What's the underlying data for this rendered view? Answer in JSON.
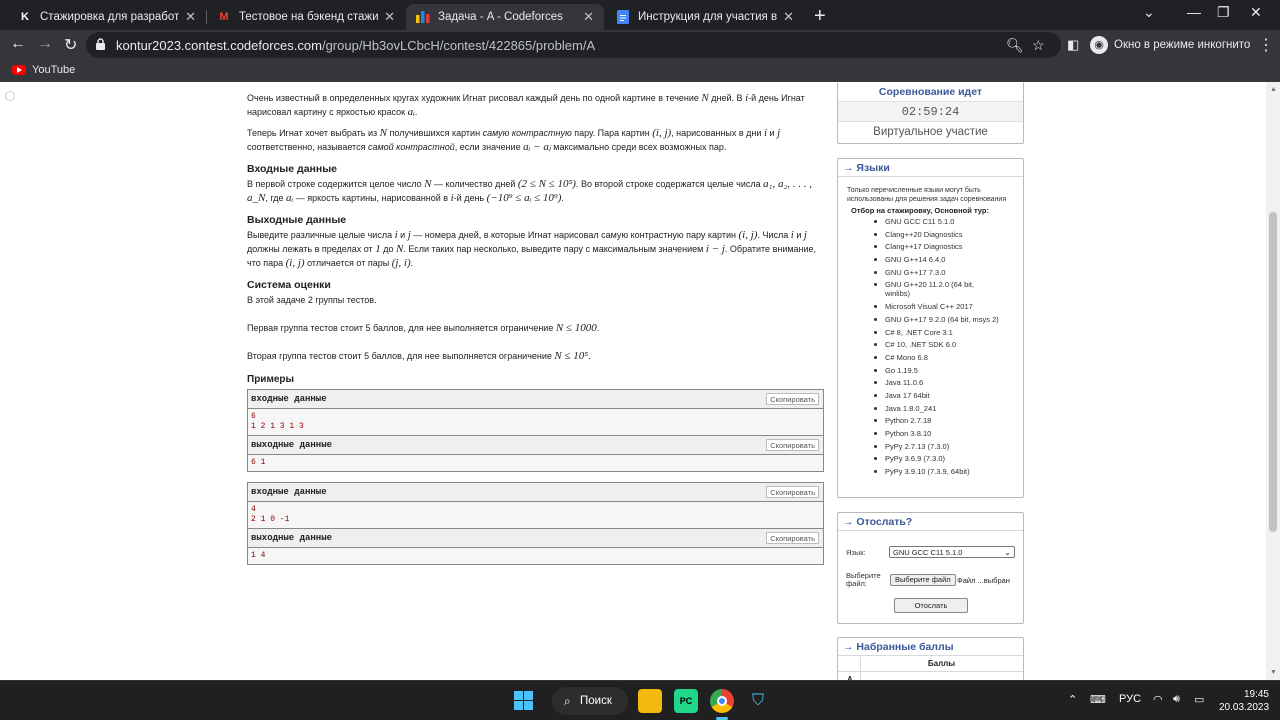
{
  "browser": {
    "tabs": [
      {
        "favicon": "K",
        "title": "Стажировка для разработчиков"
      },
      {
        "favicon": "M",
        "title": "Тестовое на бэкенд стажировку"
      },
      {
        "favicon": "cf-icon",
        "title": "Задача - A - Codeforces"
      },
      {
        "favicon": "docs-icon",
        "title": "Инструкция для участия в конте"
      }
    ],
    "url_host": "kontur2023.contest.codeforces.com",
    "url_path": "/group/Hb3ovLCbcH/contest/422865/problem/A",
    "incognito_label": "Окно в режиме инкогнито",
    "bookmark_youtube": "YouTube"
  },
  "problem": {
    "intro1_a": "Очень известный в определенных кругах художник Игнат рисовал каждый день по одной картине в течение",
    "intro1_n": "N",
    "intro1_b": "дней. В",
    "intro1_i": "i",
    "intro1_c": "-й день Игнат нарисовал картину с яркостью красок",
    "intro1_ai": "aᵢ",
    "intro2_a": "Теперь Игнат хочет выбрать из",
    "intro2_n": "N",
    "intro2_b": "получившихся картин",
    "intro2_em1": "самую контрастную",
    "intro2_c": "пару. Пара картин",
    "intro2_ij": "(i, j)",
    "intro2_d": ", нарисованных в дни",
    "intro2_i": "i",
    "intro2_e": "и",
    "intro2_j": "j",
    "intro2_f": "соответственно, называется",
    "intro2_em2": "самой контрастной",
    "intro2_g": ", если значение",
    "intro2_expr": "aᵢ − aⱼ",
    "intro2_h": "максимально среди всех возможных пар.",
    "input_title": "Входные данные",
    "input_a": "В первой строке содержится целое число",
    "input_n": "N",
    "input_b": "— количество дней",
    "input_range": "(2 ≤ N ≤ 10⁵)",
    "input_c": ". Во второй строке содержатся целые числа",
    "input_seq": "a₁, a₂, . . . , a_N",
    "input_d": ", где",
    "input_ai": "aᵢ",
    "input_e": "— яркость картины, нарисованной в",
    "input_i": "i",
    "input_f": "-й день",
    "input_range2": "(−10⁹ ≤ aᵢ ≤ 10⁹)",
    "output_title": "Выходные данные",
    "output_a": "Выведите различные целые числа",
    "output_i": "i",
    "output_b": "и",
    "output_j": "j",
    "output_c": "— номера дней, в которые Игнат нарисовал самую контрастную пару картин",
    "output_ij": "(i, j)",
    "output_d": ". Числа",
    "output_i2": "i",
    "output_e": "и",
    "output_j2": "j",
    "output_f": "должны лежать в пределах от",
    "output_1": "1",
    "output_g": "до",
    "output_n": "N",
    "output_h": ". Если таких пар несколько, выведите пару с максимальным значением",
    "output_expr": "i − j",
    "output_k": ". Обратите внимание, что пара",
    "output_ij2": "(i, j)",
    "output_l": "отличается от пары",
    "output_ji": "(j, i)",
    "output_end": ".",
    "scoring_title": "Система оценки",
    "scoring_1": "В этой задаче 2 группы тестов.",
    "scoring_2a": "Первая группа тестов стоит 5 баллов, для нее выполняется ограничение",
    "scoring_2m": "N ≤ 1000",
    "scoring_3a": "Вторая группа тестов стоит 5 баллов, для нее выполняется ограничение",
    "scoring_3m": "N ≤ 10⁵",
    "samples_title": "Примеры",
    "input_label": "входные данные",
    "output_label": "выходные данные",
    "copy_label": "Скопировать",
    "samples": [
      {
        "input_l1": "6",
        "input_l2": "1 2 1 3 1 3",
        "output": "6 1"
      },
      {
        "input_l1": "4",
        "input_l2": "2 1 0 -1",
        "output": "1 4"
      }
    ]
  },
  "sidebar": {
    "contest_status": "Соревнование идет",
    "timer": "02:59:24",
    "virtual": "Виртуальное участие",
    "languages_caption": "→ Языки",
    "languages_note": "Только перечисленные языки могут быть использованы для решения задач соревнования",
    "languages_group": "Отбор на стажировку, Основной тур:",
    "languages": [
      "GNU GCC C11 5.1.0",
      "Clang++20 Diagnostics",
      "Clang++17 Diagnostics",
      "GNU G++14 6.4.0",
      "GNU G++17 7.3.0",
      "GNU G++20 11.2.0 (64 bit, winlibs)",
      "Microsoft Visual C++ 2017",
      "GNU G++17 9.2.0 (64 bit, msys 2)",
      "C# 8, .NET Core 3.1",
      "C# 10, .NET SDK 6.0",
      "C# Mono 6.8",
      "Go 1.19.5",
      "Java 11.0.6",
      "Java 17 64bit",
      "Java 1.8.0_241",
      "Python 2.7.18",
      "Python 3.8.10",
      "PyPy 2.7.13 (7.3.0)",
      "PyPy 3.6.9 (7.3.0)",
      "PyPy 3.9.10 (7.3.9, 64bit)"
    ],
    "submit_caption": "→ Отослать?",
    "language_label": "Язык:",
    "language_selected": "GNU GCC C11 5.1.0",
    "file_label": "Выберите файл:",
    "file_button": "Выберите файл",
    "file_status": "Файл ...выбран",
    "send_button": "Отослать",
    "score_caption": "→ Набранные баллы",
    "score_header": "Баллы",
    "score_row": "A"
  },
  "taskbar": {
    "search_label": "Поиск",
    "lang": "РУС",
    "time": "19:45",
    "date": "20.03.2023"
  }
}
